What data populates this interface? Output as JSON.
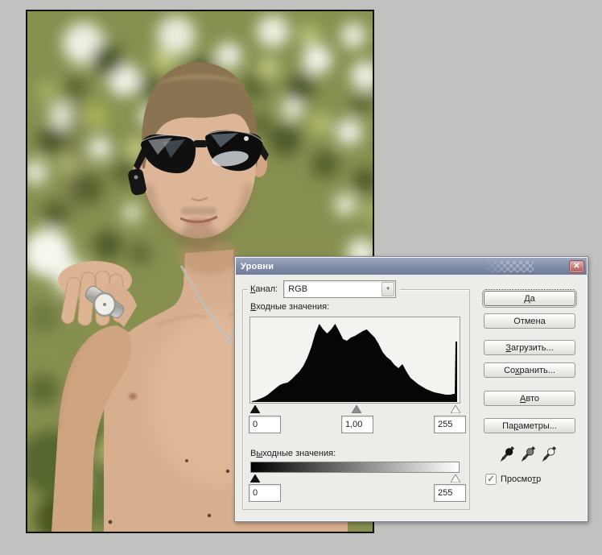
{
  "desktop": {
    "bg_color": "#c0c2bf"
  },
  "icons": {
    "close": "✕",
    "check": "✓",
    "dropdown_arrow": "▼"
  },
  "dialog": {
    "title": "Уровни",
    "channel": {
      "label": {
        "t": "Канал:",
        "u": 0
      },
      "value": "RGB"
    },
    "input_label": {
      "t": "Входные значения:",
      "u": 0
    },
    "output_label": {
      "t": "Выходные значения:",
      "u": 1
    },
    "input_fields": {
      "low": "0",
      "gamma": "1,00",
      "high": "255"
    },
    "output_fields": {
      "low": "0",
      "high": "255"
    },
    "buttons": [
      {
        "name": "ok-button",
        "label": {
          "t": "Да",
          "u": 0
        },
        "default": true
      },
      {
        "name": "cancel-button",
        "label": {
          "t": "Отмена",
          "u": -1
        },
        "default": false
      },
      {
        "name": "load-button",
        "label": {
          "t": "Загрузить...",
          "u": 0
        },
        "default": false
      },
      {
        "name": "save-button",
        "label": {
          "t": "Сохранить...",
          "u": 2
        },
        "default": false
      },
      {
        "name": "auto-button",
        "label": {
          "t": "Авто",
          "u": 0
        },
        "default": false
      },
      {
        "name": "options-button",
        "label": {
          "t": "Параметры...",
          "u": 2
        },
        "default": false
      }
    ],
    "eyedroppers": [
      {
        "name": "black-point-eyedropper-icon",
        "fill": "#111111"
      },
      {
        "name": "gray-point-eyedropper-icon",
        "fill": "#7b7b7b"
      },
      {
        "name": "white-point-eyedropper-icon",
        "fill": "#f4f4f2"
      }
    ],
    "preview": {
      "label": {
        "t": "Просмотр",
        "u": 6
      },
      "checked": true
    },
    "histogram": {
      "values": [
        0.01,
        0.02,
        0.04,
        0.06,
        0.09,
        0.13,
        0.17,
        0.21,
        0.23,
        0.24,
        0.28,
        0.33,
        0.38,
        0.45,
        0.55,
        0.68,
        0.85,
        0.97,
        0.9,
        0.85,
        0.9,
        0.97,
        0.88,
        0.78,
        0.76,
        0.8,
        0.82,
        0.85,
        0.88,
        0.9,
        0.85,
        0.8,
        0.72,
        0.62,
        0.56,
        0.52,
        0.46,
        0.42,
        0.47,
        0.38,
        0.3,
        0.26,
        0.22,
        0.19,
        0.16,
        0.14,
        0.12,
        0.11,
        0.1,
        0.09,
        0.09,
        0.1
      ],
      "right_edge_spike": 0.75
    }
  }
}
